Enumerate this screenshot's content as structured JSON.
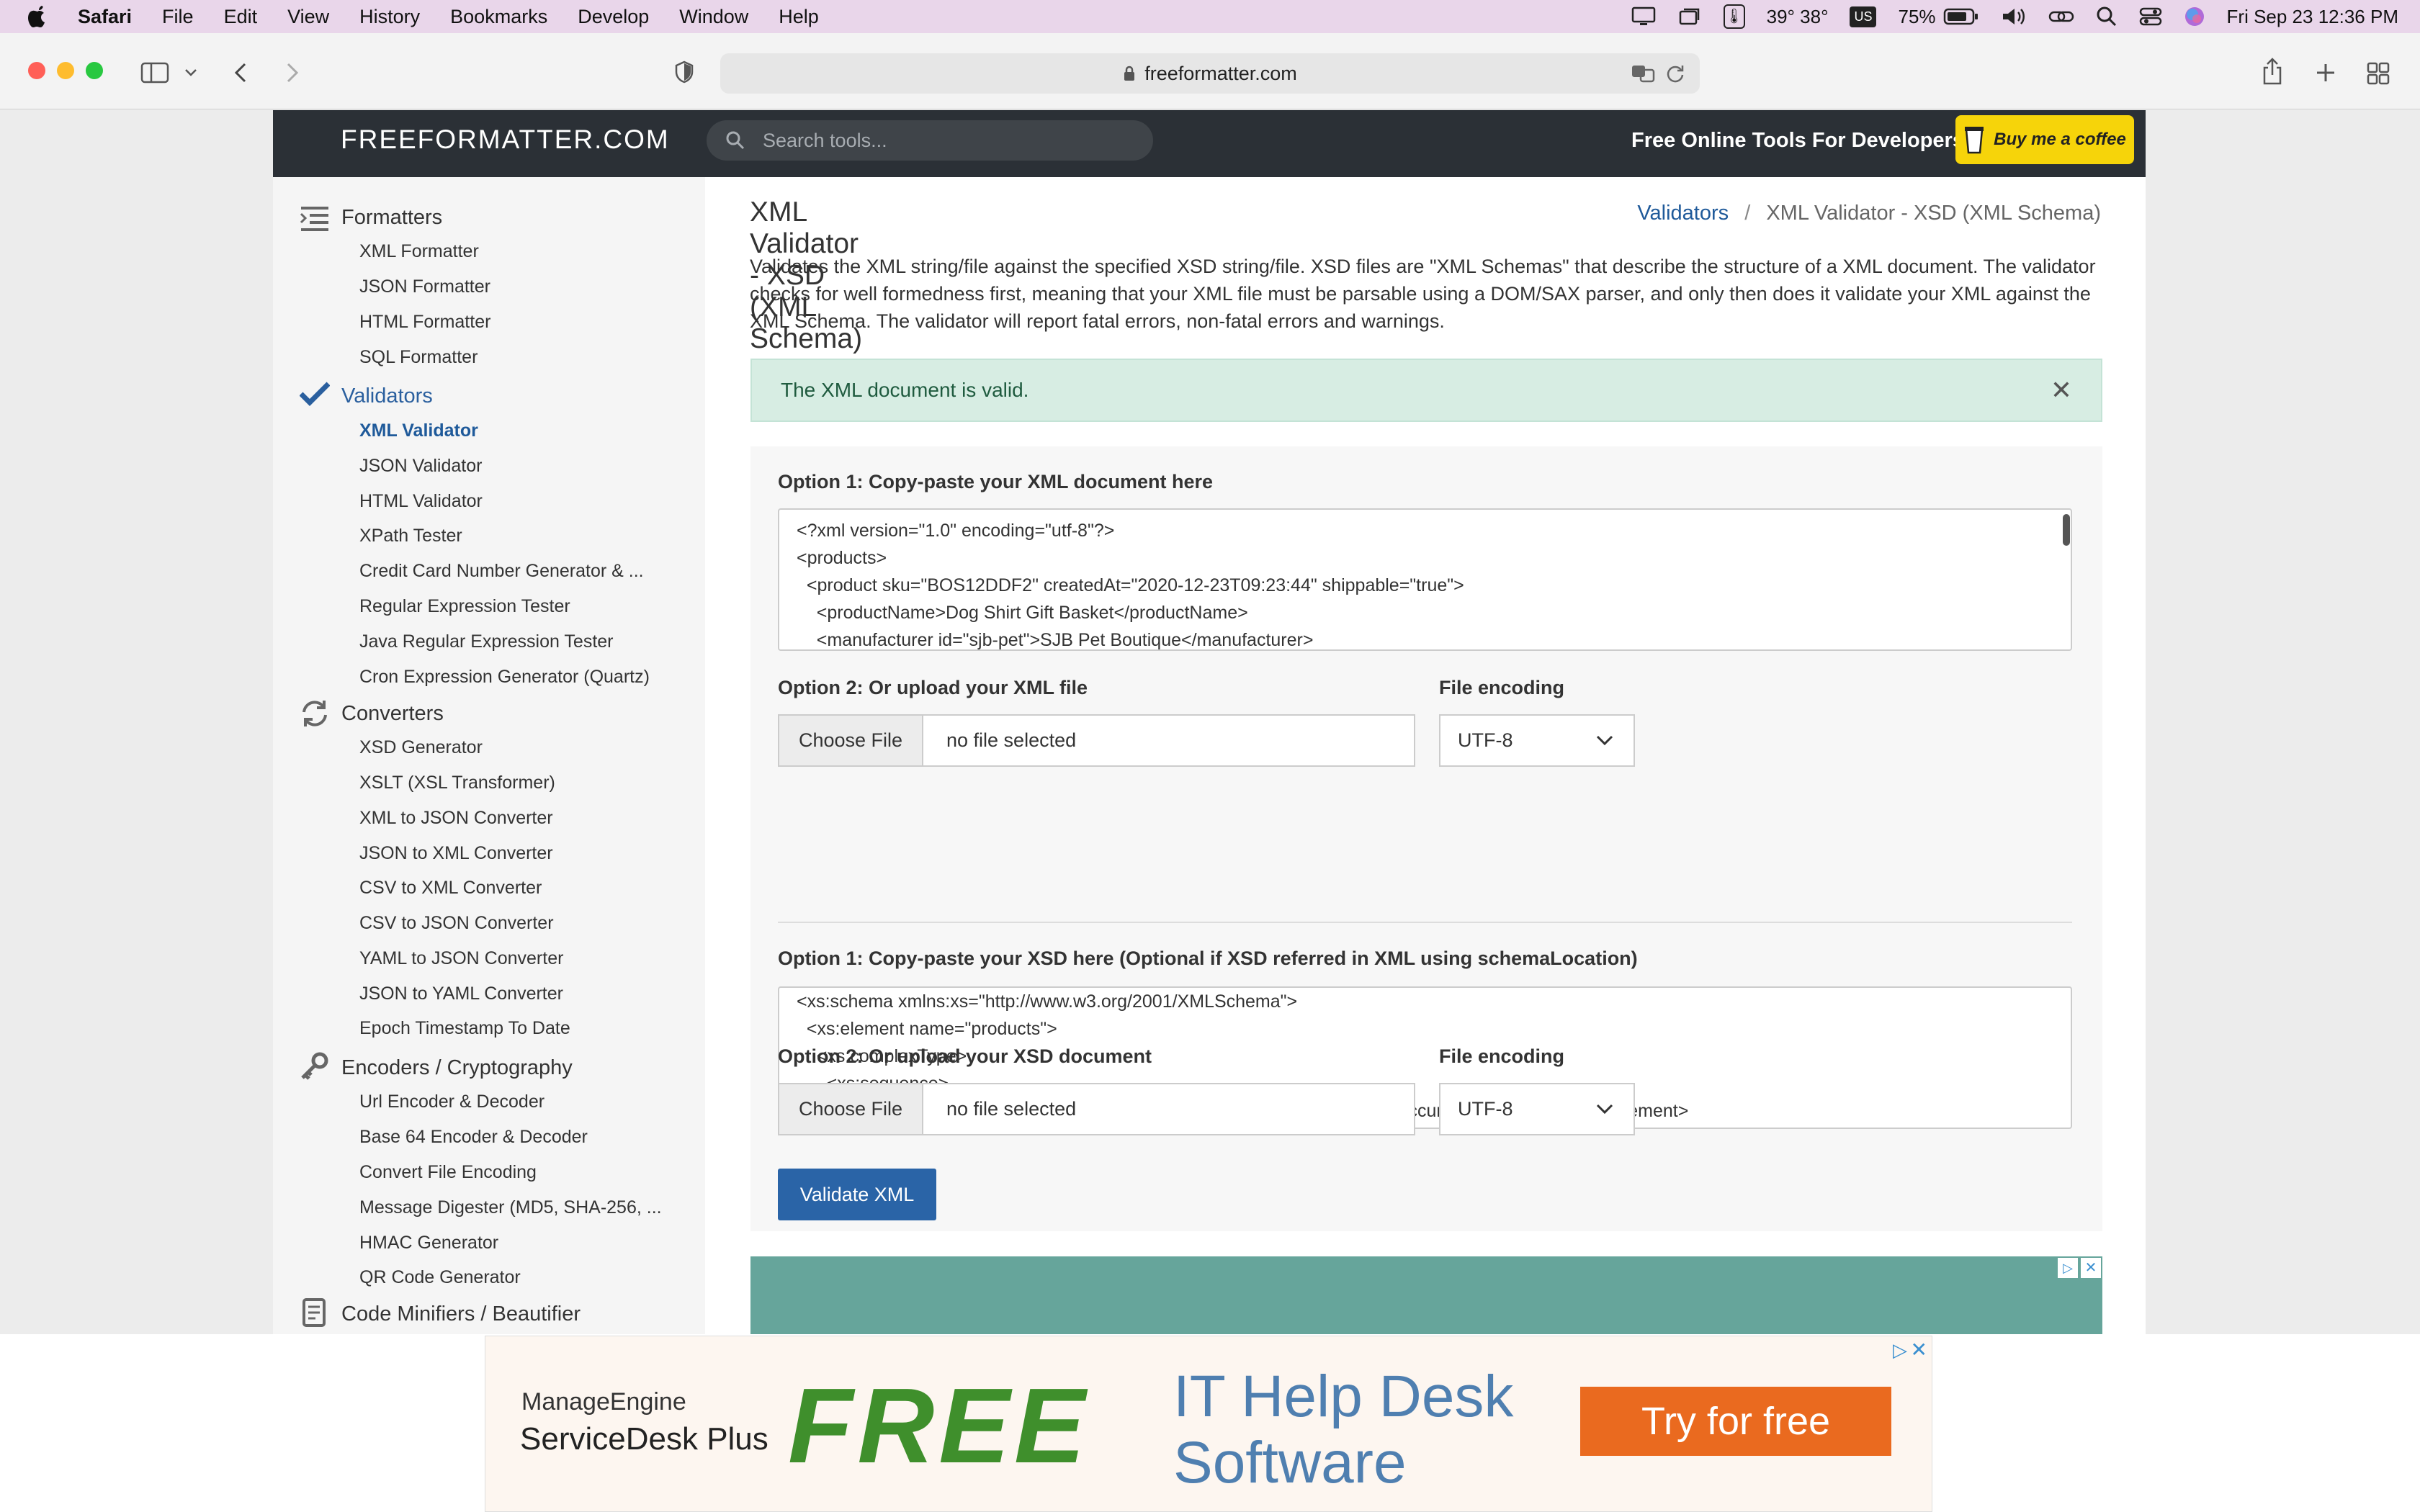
{
  "menubar": {
    "app": "Safari",
    "items": [
      "File",
      "Edit",
      "View",
      "History",
      "Bookmarks",
      "Develop",
      "Window",
      "Help"
    ],
    "weather": "39° 38°",
    "keyboard": "US",
    "battery": "75%",
    "datetime": "Fri Sep 23  12:36 PM"
  },
  "browser": {
    "url": "freeformatter.com"
  },
  "site": {
    "logo": "FREEFORMATTER.COM",
    "search_placeholder": "Search tools...",
    "tagline": "Free Online Tools For Developers",
    "coffee": "Buy me a coffee"
  },
  "sidebar": {
    "formatters": {
      "title": "Formatters",
      "items": [
        "XML Formatter",
        "JSON Formatter",
        "HTML Formatter",
        "SQL Formatter"
      ]
    },
    "validators": {
      "title": "Validators",
      "items": [
        "XML Validator",
        "JSON Validator",
        "HTML Validator",
        "XPath Tester",
        "Credit Card Number Generator & ...",
        "Regular Expression Tester",
        "Java Regular Expression Tester",
        "Cron Expression Generator (Quartz)"
      ]
    },
    "converters": {
      "title": "Converters",
      "items": [
        "XSD Generator",
        "XSLT (XSL Transformer)",
        "XML to JSON Converter",
        "JSON to XML Converter",
        "CSV to XML Converter",
        "CSV to JSON Converter",
        "YAML to JSON Converter",
        "JSON to YAML Converter",
        "Epoch Timestamp To Date"
      ]
    },
    "encoders": {
      "title": "Encoders / Cryptography",
      "items": [
        "Url Encoder & Decoder",
        "Base 64 Encoder & Decoder",
        "Convert File Encoding",
        "Message Digester (MD5, SHA-256, ...",
        "HMAC Generator",
        "QR Code Generator"
      ]
    },
    "minifiers": {
      "title": "Code Minifiers / Beautifier"
    }
  },
  "main": {
    "title": "XML Validator - XSD (XML Schema)",
    "breadcrumb_link": "Validators",
    "breadcrumb_sep": "/",
    "breadcrumb_current": "XML Validator - XSD (XML Schema)",
    "description": "Validates the XML string/file against the specified XSD string/file. XSD files are \"XML Schemas\" that describe the structure of a XML document. The validator checks for well formedness first, meaning that your XML file must be parsable using a DOM/SAX parser, and only then does it validate your XML against the XML Schema. The validator will report fatal errors, non-fatal errors and warnings.",
    "alert": "The XML document is valid.",
    "xml_label": "Option 1: Copy-paste your XML document here",
    "xml_content": "<?xml version=\"1.0\" encoding=\"utf-8\"?>\n<products>\n  <product sku=\"BOS12DDF2\" createdAt=\"2020-12-23T09:23:44\" shippable=\"true\">\n    <productName>Dog Shirt Gift Basket</productName>\n    <manufacturer id=\"sjb-pet\">SJB Pet Boutique</manufacturer>",
    "xml_upload_label": "Option 2: Or upload your XML file",
    "xsd_label": "Option 1: Copy-paste your XSD here (Optional if XSD referred in XML using schemaLocation)",
    "xsd_content": "<xs:schema xmlns:xs=\"http://www.w3.org/2001/XMLSchema\">\n  <xs:element name=\"products\">\n    <xs:complexType>\n      <xs:sequence>\n        <xs:element name=\"product\" type=\"ProductType\" minOccurs=\"0\" maxOccurs=\"unbounded\"></xs:element>",
    "xsd_upload_label": "Option 2: Or upload your XSD document",
    "encoding_label": "File encoding",
    "choose_file": "Choose File",
    "no_file": "no file selected",
    "encoding_value": "UTF-8",
    "validate_button": "Validate XML"
  },
  "ad": {
    "brand1": "ManageEngine",
    "brand2": "ServiceDesk Plus",
    "free": "FREE",
    "headline1": "IT Help Desk",
    "headline2": "Software",
    "cta": "Try for free"
  }
}
